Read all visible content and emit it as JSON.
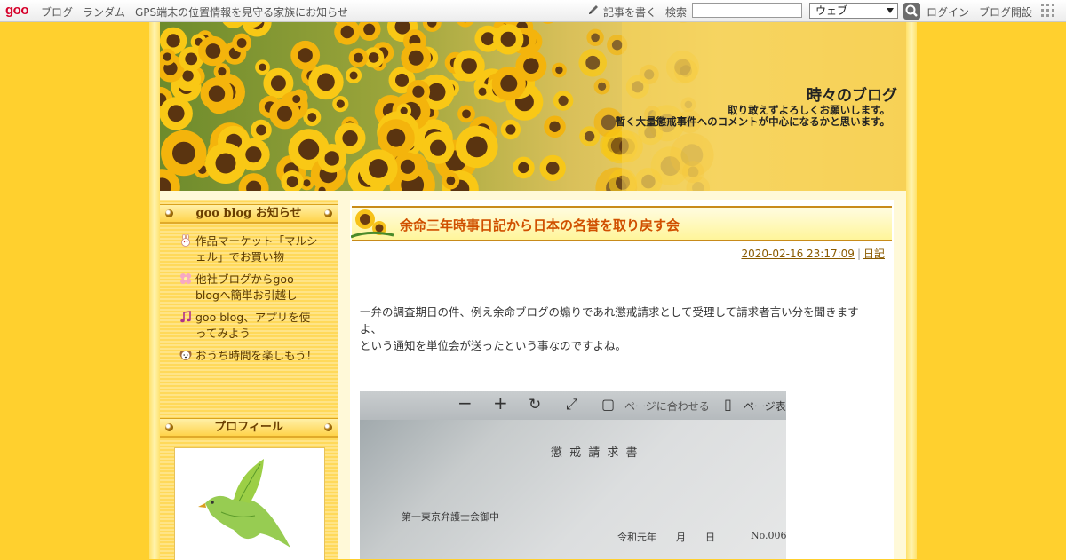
{
  "toolbar": {
    "logo": "goo",
    "links": [
      "ブログ",
      "ランダム",
      "GPS端末の位置情報を見守る家族にお知らせ"
    ],
    "write_label": "記事を書く",
    "search_label": "検索",
    "search_value": "",
    "select_value": "ウェブ",
    "login_label": "ログイン",
    "open_blog_label": "ブログ開設"
  },
  "header": {
    "title": "時々のブログ",
    "description_lines": [
      "取り敢えずよろしくお願いします。",
      "暫く大量懲戒事件へのコメントが中心になるかと思います。"
    ]
  },
  "sidebar": {
    "notice_heading": "goo blog お知らせ",
    "notices": [
      {
        "text": "作品マーケット「マルシェル」でお買い物",
        "icon": "rabbit-icon"
      },
      {
        "text": "他社ブログからgoo blogへ簡単お引越し",
        "icon": "flower-icon"
      },
      {
        "text": "goo blog、アプリを使ってみよう",
        "icon": "music-note-icon"
      },
      {
        "text": "おうち時間を楽しもう！",
        "icon": "dog-icon"
      }
    ],
    "profile_heading": "プロフィール"
  },
  "entry": {
    "title": "余命三年時事日記から日本の名誉を取り戻す会",
    "datetime": "2020-02-16 23:17:09",
    "category": "日記",
    "body_line1": "一弁の調査期日の件、例え余命ブログの煽りであれ懲戒請求として受理して請求者言い分を聞きます",
    "body_line2": "よ、",
    "body_line3": "という通知を単位会が送ったという事なのですよね。",
    "image_texts": {
      "toolbar_fit": "ページに合わせる",
      "toolbar_page": "ページ表示",
      "doc_title": "懲 戒 請 求 書",
      "doc_addressee": "第一東京弁護士会御中",
      "doc_date": "令和元年　　月　　日",
      "doc_no": "No.006"
    }
  },
  "colors": {
    "background": "#ffd02e",
    "entry_title": "#d05000",
    "meta_link": "#8a5a00"
  }
}
